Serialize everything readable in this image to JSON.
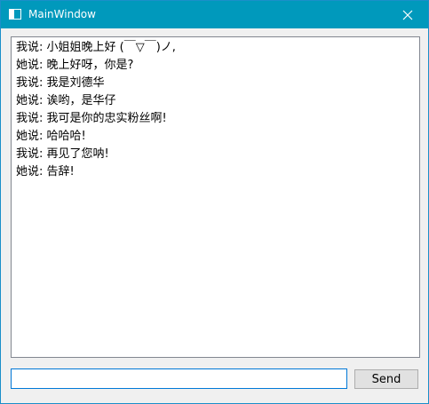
{
  "window": {
    "title": "MainWindow",
    "app_icon": "window-icon",
    "close_icon": "close-icon"
  },
  "chat": {
    "messages": [
      "我说: 小姐姐晚上好 (￣▽￣)ノ,",
      "她说: 晚上好呀，你是?",
      "我说: 我是刘德华",
      "她说: 诶哟，是华仔",
      "我说: 我可是你的忠实粉丝啊!",
      "她说: 哈哈哈!",
      "我说: 再见了您呐!",
      "她说: 告辞!"
    ]
  },
  "input": {
    "value": "",
    "placeholder": ""
  },
  "send": {
    "label": "Send"
  },
  "colors": {
    "titlebar": "#0099bc",
    "input_focus_border": "#0078d7",
    "button_bg": "#e1e1e1"
  }
}
